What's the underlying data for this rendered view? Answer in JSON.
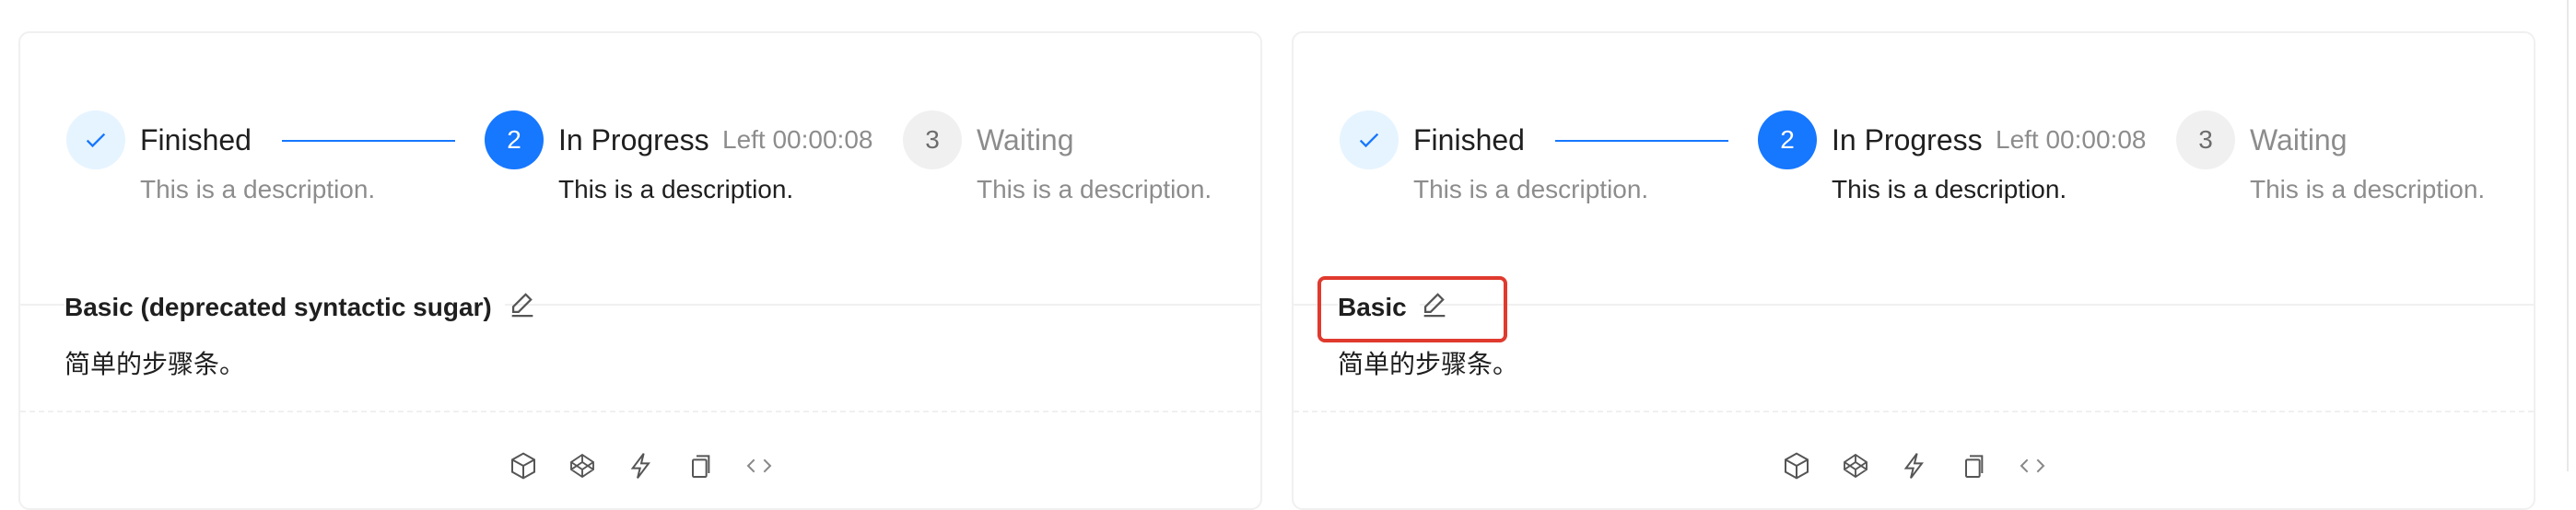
{
  "steps": [
    {
      "title": "Finished",
      "description": "This is a description."
    },
    {
      "number": "2",
      "title": "In Progress",
      "subtitle": "Left 00:00:08",
      "description": "This is a description."
    },
    {
      "number": "3",
      "title": "Waiting",
      "description": "This is a description."
    }
  ],
  "demos": [
    {
      "title": "Basic (deprecated syntactic sugar)",
      "description": "简单的步骤条。"
    },
    {
      "title": "Basic",
      "description": "简单的步骤条。"
    }
  ],
  "icons": {
    "finished": "check-icon",
    "edit": "edit-icon",
    "actions": [
      "codesandbox-icon",
      "codepen-icon",
      "stackblitz-icon",
      "copy-icon",
      "code-icon"
    ]
  },
  "colors": {
    "primary": "#1677ff",
    "highlight": "#e03a2e"
  }
}
